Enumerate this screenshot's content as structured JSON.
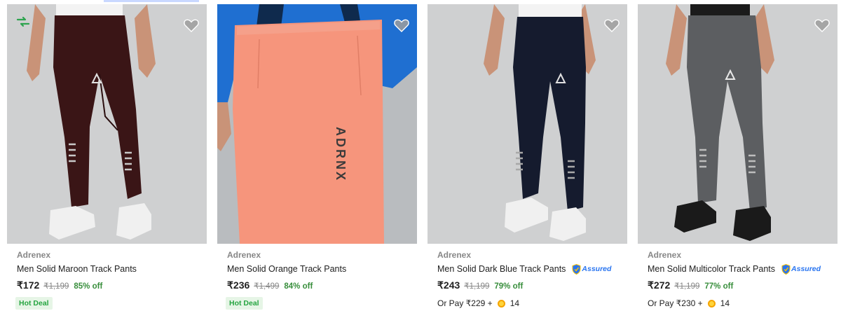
{
  "products": [
    {
      "brand": "Adrenex",
      "title": "Men Solid Maroon Track Pants",
      "price": "₹172",
      "mrp": "₹1,199",
      "discount": "85% off",
      "tag": "Hot Deal",
      "assured": "",
      "or_pay_text": "",
      "coins": "",
      "pant_color": "#3a1516",
      "bg_color": "#cfd0d1"
    },
    {
      "brand": "Adrenex",
      "title": "Men Solid Orange Track Pants",
      "price": "₹236",
      "mrp": "₹1,499",
      "discount": "84% off",
      "tag": "Hot Deal",
      "assured": "",
      "or_pay_text": "",
      "coins": "",
      "pant_color": "#f6957c",
      "bg_color": "#b9bcbf",
      "logo_text": "ADRNX"
    },
    {
      "brand": "Adrenex",
      "title": "Men Solid Dark Blue Track Pants",
      "price": "₹243",
      "mrp": "₹1,199",
      "discount": "79% off",
      "tag": "",
      "assured": "Assured",
      "or_pay_text": "Or Pay ₹229 +",
      "coins": "14",
      "pant_color": "#151b2e",
      "bg_color": "#cfd0d1"
    },
    {
      "brand": "Adrenex",
      "title": "Men Solid Multicolor Track Pants",
      "price": "₹272",
      "mrp": "₹1,199",
      "discount": "77% off",
      "tag": "",
      "assured": "Assured",
      "or_pay_text": "Or Pay ₹230 +",
      "coins": "14",
      "pant_color": "#5c5e61",
      "bg_color": "#cfd0d1"
    }
  ],
  "icons": {
    "wishlist": "heart-icon",
    "compare": "compare-arrows-icon",
    "assured": "assured-shield-icon",
    "coin": "supercoin-icon"
  },
  "colors": {
    "discount": "#388e3c",
    "assured_blue": "#2874f0",
    "hot_deal_green": "#26a541"
  }
}
